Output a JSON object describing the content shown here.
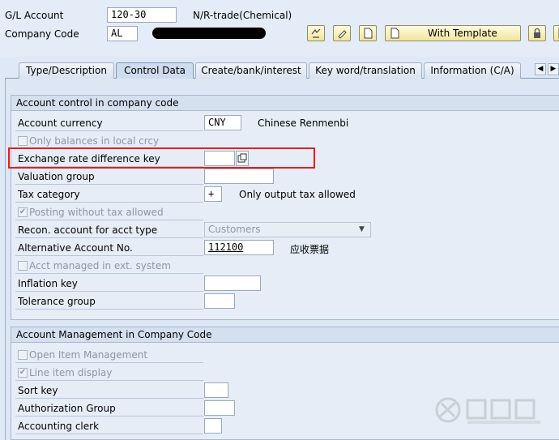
{
  "header": {
    "gl_account_label": "G/L Account",
    "gl_account_value": "120-30",
    "gl_account_desc": "N/R-trade(Chemical)",
    "company_code_label": "Company Code",
    "company_code_value": "AL",
    "with_template_label": "With Template"
  },
  "tabs": [
    {
      "label": "Type/Description"
    },
    {
      "label": "Control Data"
    },
    {
      "label": "Create/bank/interest"
    },
    {
      "label": "Key word/translation"
    },
    {
      "label": "Information (C/A)"
    }
  ],
  "account_control": {
    "title": "Account control in company code",
    "currency_label": "Account currency",
    "currency_value": "CNY",
    "currency_desc": "Chinese Renmenbi",
    "only_balances_label": "Only balances in local crcy",
    "exch_key_label": "Exchange rate difference key",
    "exch_key_value": "",
    "valuation_group_label": "Valuation group",
    "tax_category_label": "Tax category",
    "tax_category_value": "+",
    "tax_category_desc": "Only output tax allowed",
    "posting_without_tax_label": "Posting without tax allowed",
    "recon_label": "Recon. account for acct type",
    "recon_value": "Customers",
    "alt_account_label": "Alternative Account No.",
    "alt_account_value": "112100",
    "alt_account_desc": "应收票据",
    "acct_managed_label": "Acct managed in ext. system",
    "inflation_key_label": "Inflation key",
    "tolerance_group_label": "Tolerance group"
  },
  "account_management": {
    "title": "Account Management in Company Code",
    "open_item_label": "Open Item Management",
    "line_item_label": "Line item display",
    "sort_key_label": "Sort key",
    "auth_group_label": "Authorization Group",
    "accounting_clerk_label": "Accounting clerk"
  },
  "colors": {
    "highlight": "#e02020",
    "button_yellow": "#f2e59a",
    "background": "#dfe9f5"
  }
}
